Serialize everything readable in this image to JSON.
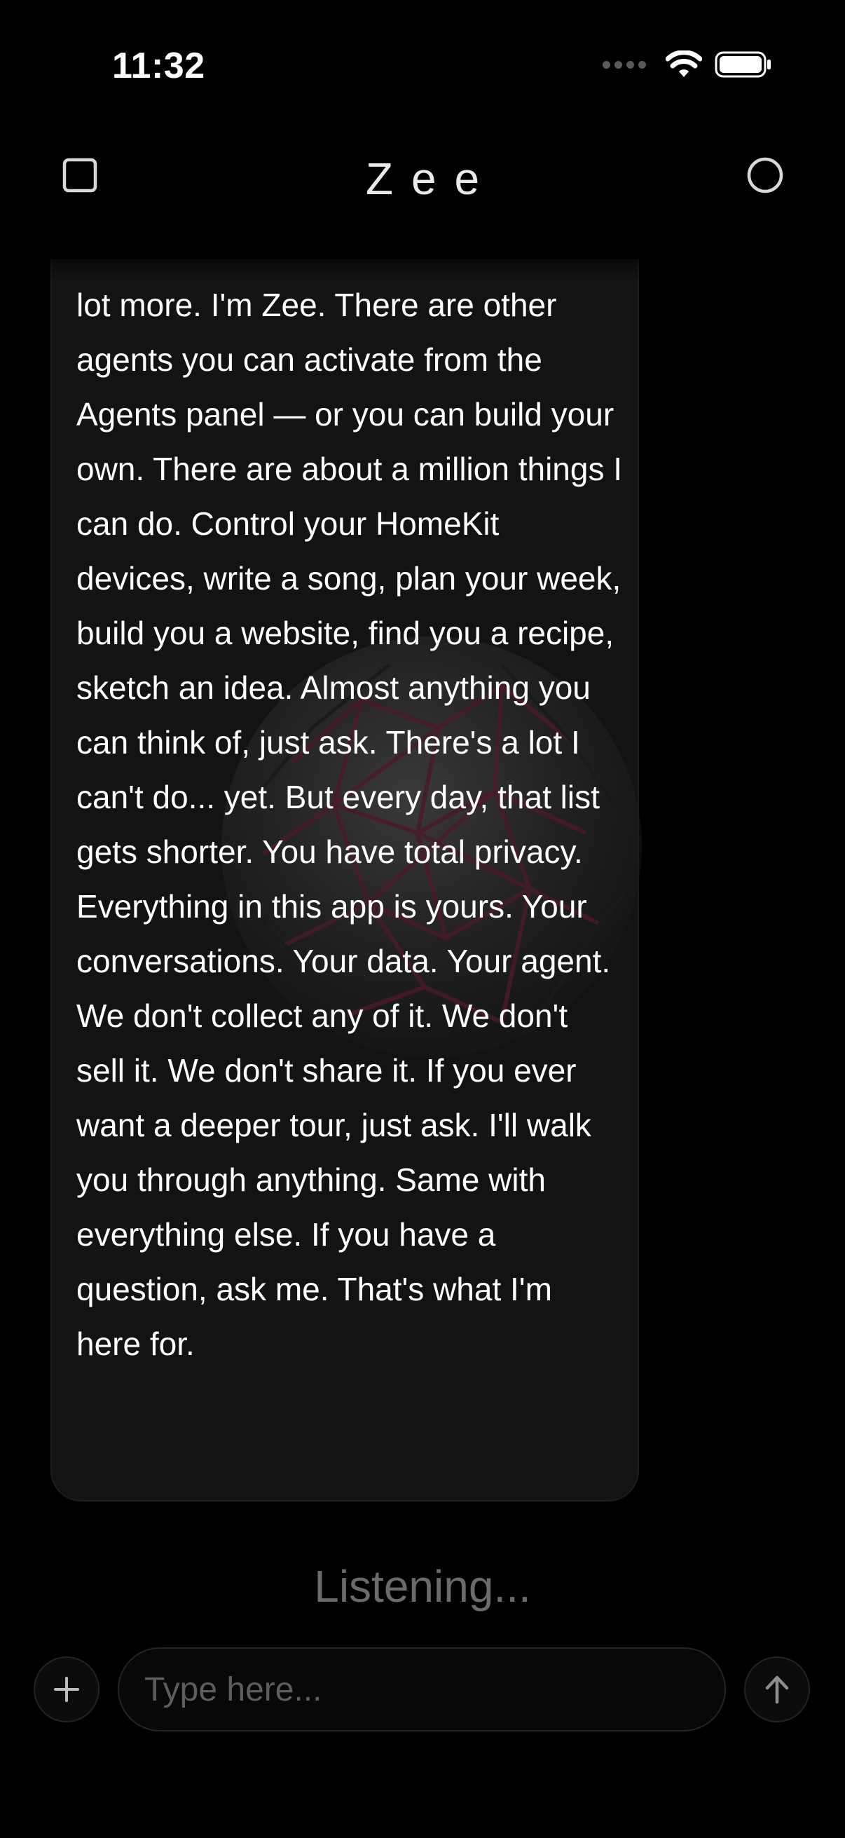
{
  "status_bar": {
    "time": "11:32",
    "icons": [
      "signal-icon",
      "wifi-icon",
      "battery-icon"
    ]
  },
  "header": {
    "title": "Zee",
    "left_icon": "square-icon",
    "right_icon": "circle-icon"
  },
  "message": {
    "text": "lot more. I'm Zee. There are other agents you can activate from the Agents panel — or you can build your own. There are about a million things I can do. Control your HomeKit devices, write a song, plan your week, build you a website, find you a recipe, sketch an idea. Almost anything you can think of, just ask. There's a lot I can't do... yet. But every day, that list gets shorter. You have total privacy. Everything in this app is yours. Your conversations. Your data. Your agent. We don't collect any of it. We don't sell it. We don't share it. If you ever want a deeper tour, just ask. I'll walk you through anything. Same with everything else. If you have a question, ask me. That's what I'm here for."
  },
  "status_text": "Listening...",
  "input": {
    "placeholder": "Type here...",
    "value": ""
  },
  "colors": {
    "background": "#000000",
    "bubble": "#1e1e1e",
    "accent": "#c2185b",
    "muted_text": "#6b6b6b"
  }
}
